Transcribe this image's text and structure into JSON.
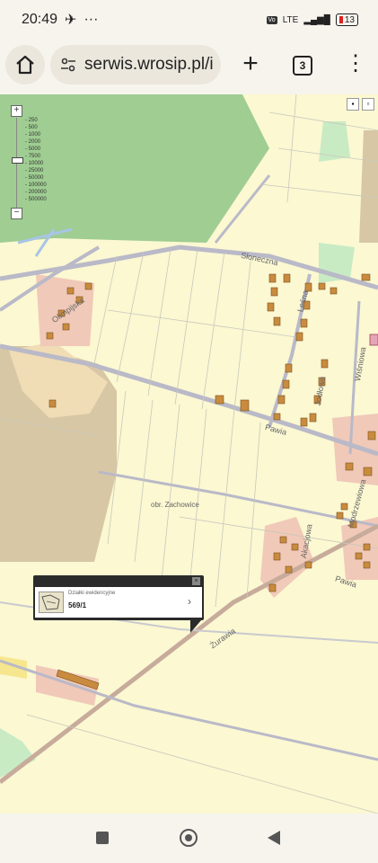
{
  "status": {
    "time": "20:49",
    "network": "LTE",
    "battery": "13"
  },
  "browser": {
    "url": "serwis.wrosip.pl/i",
    "tab_count": "3",
    "new_tab": "+",
    "menu": "⋮"
  },
  "map": {
    "scale_levels": [
      "250",
      "500",
      "1000",
      "2000",
      "5000",
      "7500",
      "10000",
      "25000",
      "50000",
      "100000",
      "200000",
      "500000"
    ],
    "zoom_in": "+",
    "zoom_out": "−",
    "streets": {
      "sloneczna": "Słoneczna",
      "lesna": "Leśna",
      "olimpijska": "Olimpijska",
      "pawia": "Pawia",
      "pawia2": "Pawia",
      "jodlowa": "Jodłowa",
      "wisniowa": "Wiśniowa",
      "zurawia": "Żurawia",
      "modrzewiowa": "Modrzewiowa",
      "akacjowa": "Akacjowa",
      "district": "obr. Zachowice"
    },
    "popup": {
      "title": "Działki ewidencyjne",
      "parcel": "569/1",
      "close": "×",
      "chevron": "›"
    }
  }
}
